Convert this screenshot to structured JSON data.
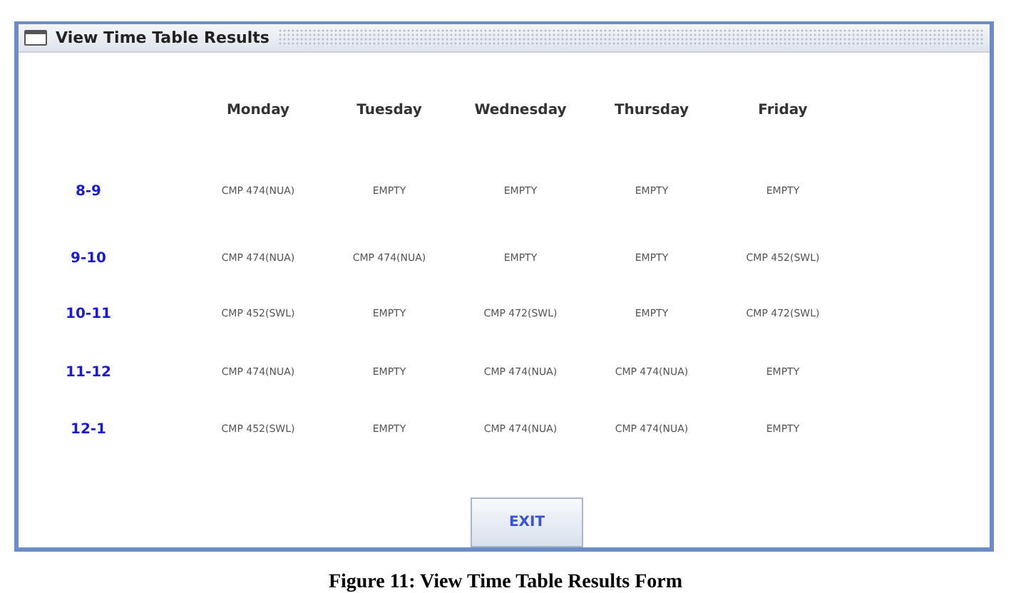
{
  "window": {
    "title": "View Time Table Results"
  },
  "timetable": {
    "days": [
      "Monday",
      "Tuesday",
      "Wednesday",
      "Thursday",
      "Friday"
    ],
    "rows": [
      {
        "time": "8-9",
        "cells": [
          "CMP 474(NUA)",
          "EMPTY",
          "EMPTY",
          "EMPTY",
          "EMPTY"
        ]
      },
      {
        "time": "9-10",
        "cells": [
          "CMP 474(NUA)",
          "CMP 474(NUA)",
          "EMPTY",
          "EMPTY",
          "CMP 452(SWL)"
        ]
      },
      {
        "time": "10-11",
        "cells": [
          "CMP 452(SWL)",
          "EMPTY",
          "CMP 472(SWL)",
          "EMPTY",
          "CMP 472(SWL)"
        ]
      },
      {
        "time": "11-12",
        "cells": [
          "CMP 474(NUA)",
          "EMPTY",
          "CMP 474(NUA)",
          "CMP 474(NUA)",
          "EMPTY"
        ]
      },
      {
        "time": "12-1",
        "cells": [
          "CMP 452(SWL)",
          "EMPTY",
          "CMP 474(NUA)",
          "CMP 474(NUA)",
          "EMPTY"
        ]
      }
    ]
  },
  "exit_button": "EXIT",
  "caption": "Figure 11: View Time Table Results Form"
}
